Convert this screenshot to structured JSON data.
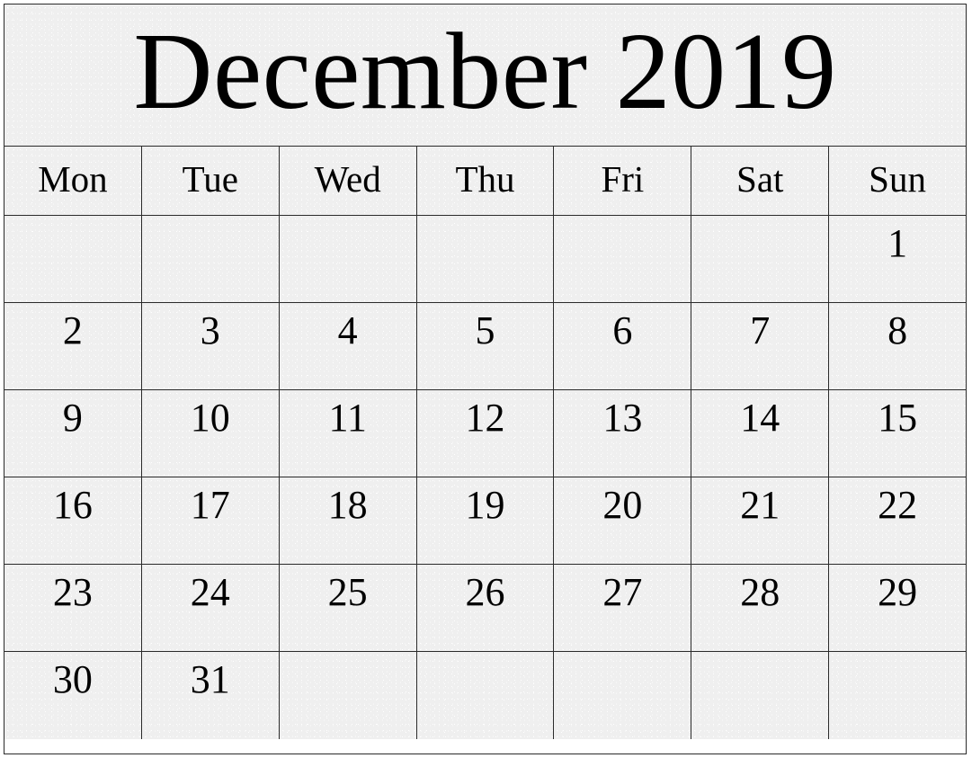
{
  "calendar": {
    "title": "December 2019",
    "month_name": "December",
    "year": "2019",
    "weekday_headers": [
      "Mon",
      "Tue",
      "Wed",
      "Thu",
      "Fri",
      "Sat",
      "Sun"
    ],
    "week_start": "Mon",
    "weeks": [
      [
        "",
        "",
        "",
        "",
        "",
        "",
        "1"
      ],
      [
        "2",
        "3",
        "4",
        "5",
        "6",
        "7",
        "8"
      ],
      [
        "9",
        "10",
        "11",
        "12",
        "13",
        "14",
        "15"
      ],
      [
        "16",
        "17",
        "18",
        "19",
        "20",
        "21",
        "22"
      ],
      [
        "23",
        "24",
        "25",
        "26",
        "27",
        "28",
        "29"
      ],
      [
        "30",
        "31",
        "",
        "",
        "",
        "",
        ""
      ]
    ],
    "colors": {
      "cell_background": "#efefef",
      "border": "#2b2b2b",
      "text": "#000000",
      "page_background": "#ffffff"
    }
  }
}
